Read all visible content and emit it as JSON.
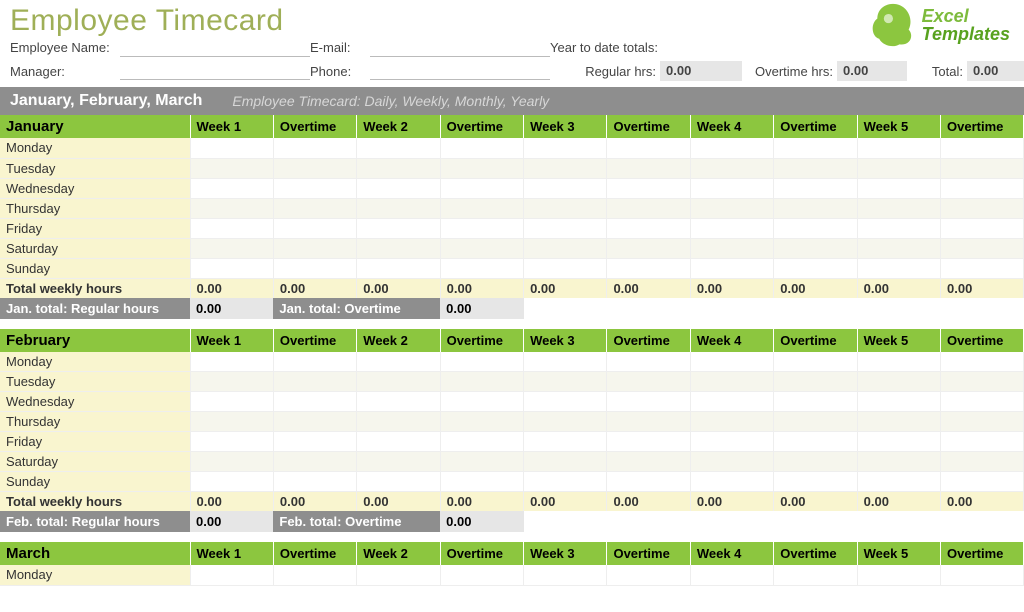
{
  "title": "Employee Timecard",
  "logo_text1": "Excel",
  "logo_text2": "Templates",
  "meta": {
    "employee_name_label": "Employee Name:",
    "email_label": "E-mail:",
    "ytd_label": "Year to date totals:",
    "manager_label": "Manager:",
    "phone_label": "Phone:",
    "regular_hrs_label": "Regular hrs:",
    "regular_hrs_value": "0.00",
    "overtime_hrs_label": "Overtime hrs:",
    "overtime_hrs_value": "0.00",
    "total_label": "Total:",
    "total_value": "0.00"
  },
  "quarter_bar_title": "January, February, March",
  "quarter_bar_sub": "Employee Timecard: Daily, Weekly, Monthly, Yearly",
  "columns": [
    "Week 1",
    "Overtime",
    "Week 2",
    "Overtime",
    "Week 3",
    "Overtime",
    "Week 4",
    "Overtime",
    "Week 5",
    "Overtime"
  ],
  "days": [
    "Monday",
    "Tuesday",
    "Wednesday",
    "Thursday",
    "Friday",
    "Saturday",
    "Sunday"
  ],
  "total_weekly_hours_label": "Total weekly hours",
  "zero": "0.00",
  "months": {
    "jan": {
      "name": "January",
      "reg_total_label": "Jan. total: Regular hours",
      "reg_total_value": "0.00",
      "ot_total_label": "Jan. total: Overtime",
      "ot_total_value": "0.00"
    },
    "feb": {
      "name": "February",
      "reg_total_label": "Feb. total: Regular hours",
      "reg_total_value": "0.00",
      "ot_total_label": "Feb.  total: Overtime",
      "ot_total_value": "0.00"
    },
    "mar": {
      "name": "March"
    }
  }
}
